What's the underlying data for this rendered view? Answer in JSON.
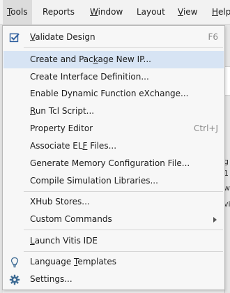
{
  "menubar": {
    "items": [
      {
        "label": "Tools",
        "mnemonic": "T",
        "rest": "ools",
        "active": true
      },
      {
        "label": "Reports",
        "mnemonic": "",
        "rest": "Reports"
      },
      {
        "label": "Window",
        "mnemonic": "W",
        "rest": "indow"
      },
      {
        "label": "Layout",
        "mnemonic": "",
        "rest": "Layout"
      },
      {
        "label": "View",
        "mnemonic": "V",
        "rest": "iew"
      },
      {
        "label": "Help",
        "mnemonic": "H",
        "rest": "elp"
      }
    ]
  },
  "menu": {
    "items": [
      {
        "pre": "",
        "mn": "V",
        "post": "alidate Design",
        "shortcut": "F6",
        "icon": "checkbox-checked-icon"
      },
      {
        "pre": "Create and Pac",
        "mn": "k",
        "post": "age New IP...",
        "highlighted": true
      },
      {
        "pre": "Create Interface Definition...",
        "mn": "",
        "post": ""
      },
      {
        "pre": "Enable Dynamic Function eXchange...",
        "mn": "",
        "post": ""
      },
      {
        "pre": "",
        "mn": "R",
        "post": "un Tcl Script..."
      },
      {
        "pre": "Property Editor",
        "mn": "",
        "post": "",
        "shortcut": "Ctrl+J"
      },
      {
        "pre": "Associate EL",
        "mn": "F",
        "post": " Files..."
      },
      {
        "pre": "Generate Memory Configuration File...",
        "mn": "",
        "post": ""
      },
      {
        "pre": "Compile Simulation Libraries...",
        "mn": "",
        "post": ""
      },
      {
        "pre": "XHub Stores...",
        "mn": "",
        "post": ""
      },
      {
        "pre": "Custom Commands",
        "mn": "",
        "post": "",
        "submenu": true
      },
      {
        "pre": "",
        "mn": "L",
        "post": "aunch Vitis IDE"
      },
      {
        "pre": "Language ",
        "mn": "T",
        "post": "emplates",
        "icon": "lightbulb-icon"
      },
      {
        "pre": "Settings...",
        "mn": "",
        "post": "",
        "icon": "gear-icon"
      }
    ]
  },
  "background": {
    "fragments": [
      "g",
      "1",
      "w",
      "vi"
    ]
  }
}
